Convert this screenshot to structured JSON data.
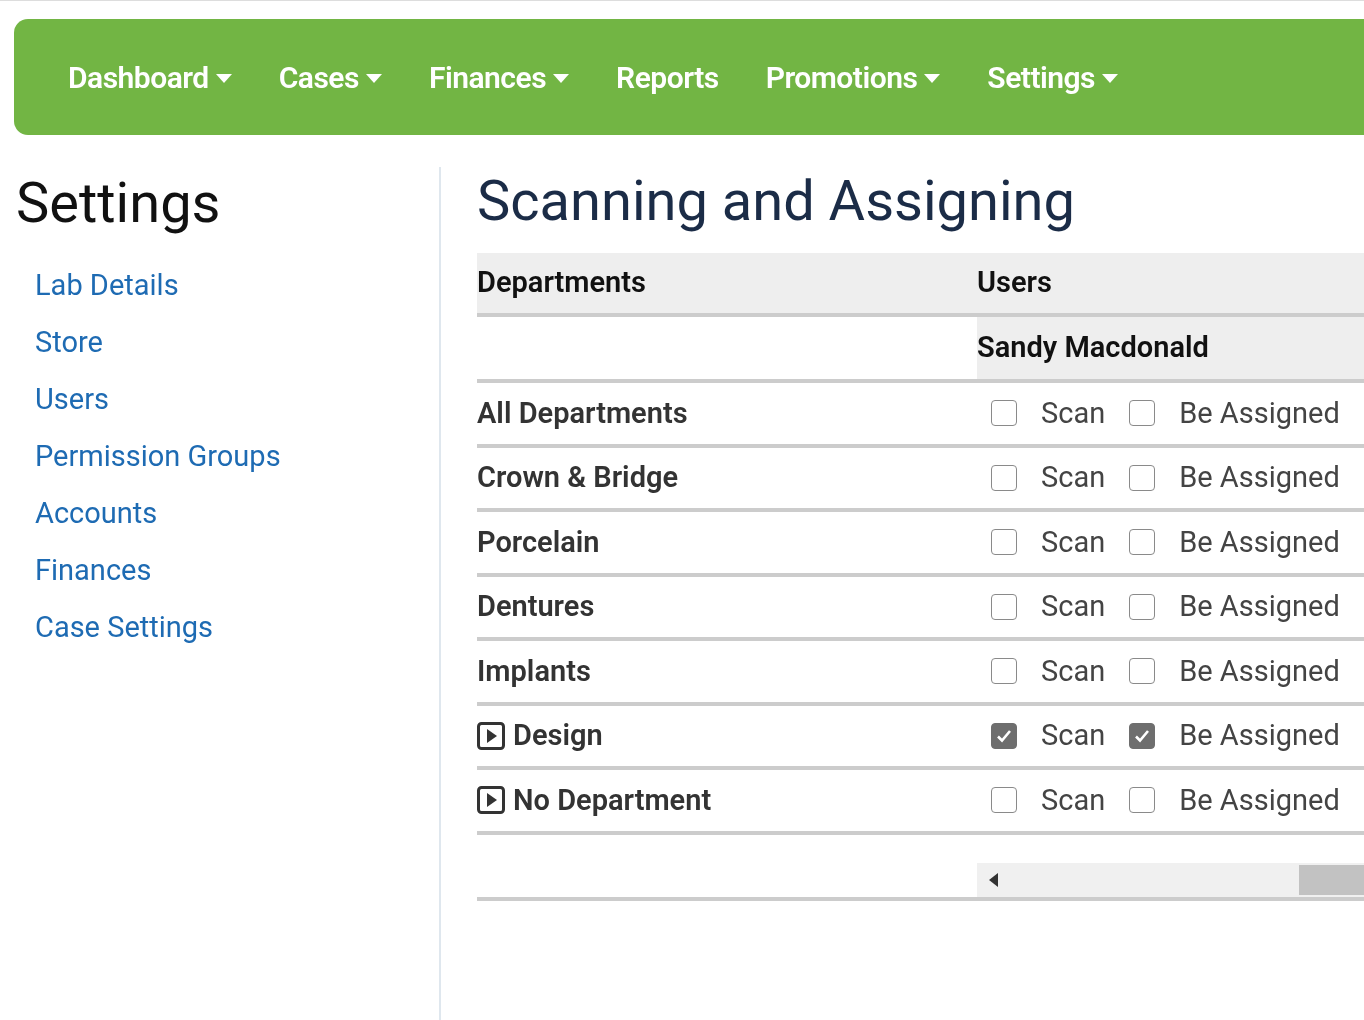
{
  "nav": [
    {
      "label": "Dashboard",
      "dropdown": true
    },
    {
      "label": "Cases",
      "dropdown": true
    },
    {
      "label": "Finances",
      "dropdown": true
    },
    {
      "label": "Reports",
      "dropdown": false
    },
    {
      "label": "Promotions",
      "dropdown": true
    },
    {
      "label": "Settings",
      "dropdown": true
    }
  ],
  "sidebar": {
    "title": "Settings",
    "items": [
      "Lab Details",
      "Store",
      "Users",
      "Permission Groups",
      "Accounts",
      "Finances",
      "Case Settings"
    ]
  },
  "page_title": "Scanning and Assigning",
  "table": {
    "columns": [
      "Departments",
      "Users"
    ],
    "user": "Sandy Macdonald",
    "rows": [
      {
        "name": "All Departments",
        "kind": "plain",
        "scan": {
          "label": "Scan",
          "checked": false
        },
        "assign": {
          "label": "Be Assigned",
          "checked": false
        }
      },
      {
        "name": "Crown & Bridge",
        "kind": "plain",
        "scan": {
          "label": "Scan",
          "checked": false
        },
        "assign": {
          "label": "Be Assigned",
          "checked": false
        }
      },
      {
        "name": "Porcelain",
        "kind": "plain",
        "scan": {
          "label": "Scan",
          "checked": false
        },
        "assign": {
          "label": "Be Assigned",
          "checked": false
        }
      },
      {
        "name": "Dentures",
        "kind": "plain",
        "scan": {
          "label": "Scan",
          "checked": false
        },
        "assign": {
          "label": "Be Assigned",
          "checked": false
        }
      },
      {
        "name": "Implants",
        "kind": "plain",
        "scan": {
          "label": "Scan",
          "checked": false
        },
        "assign": {
          "label": "Be Assigned",
          "checked": false
        }
      },
      {
        "name": "Design",
        "kind": "expandable",
        "scan": {
          "label": "Scan",
          "checked": true
        },
        "assign": {
          "label": "Be Assigned",
          "checked": true
        }
      },
      {
        "name": "No Department",
        "kind": "expandable",
        "scan": {
          "label": "Scan",
          "checked": false
        },
        "assign": {
          "label": "Be Assigned",
          "checked": false
        }
      }
    ]
  }
}
